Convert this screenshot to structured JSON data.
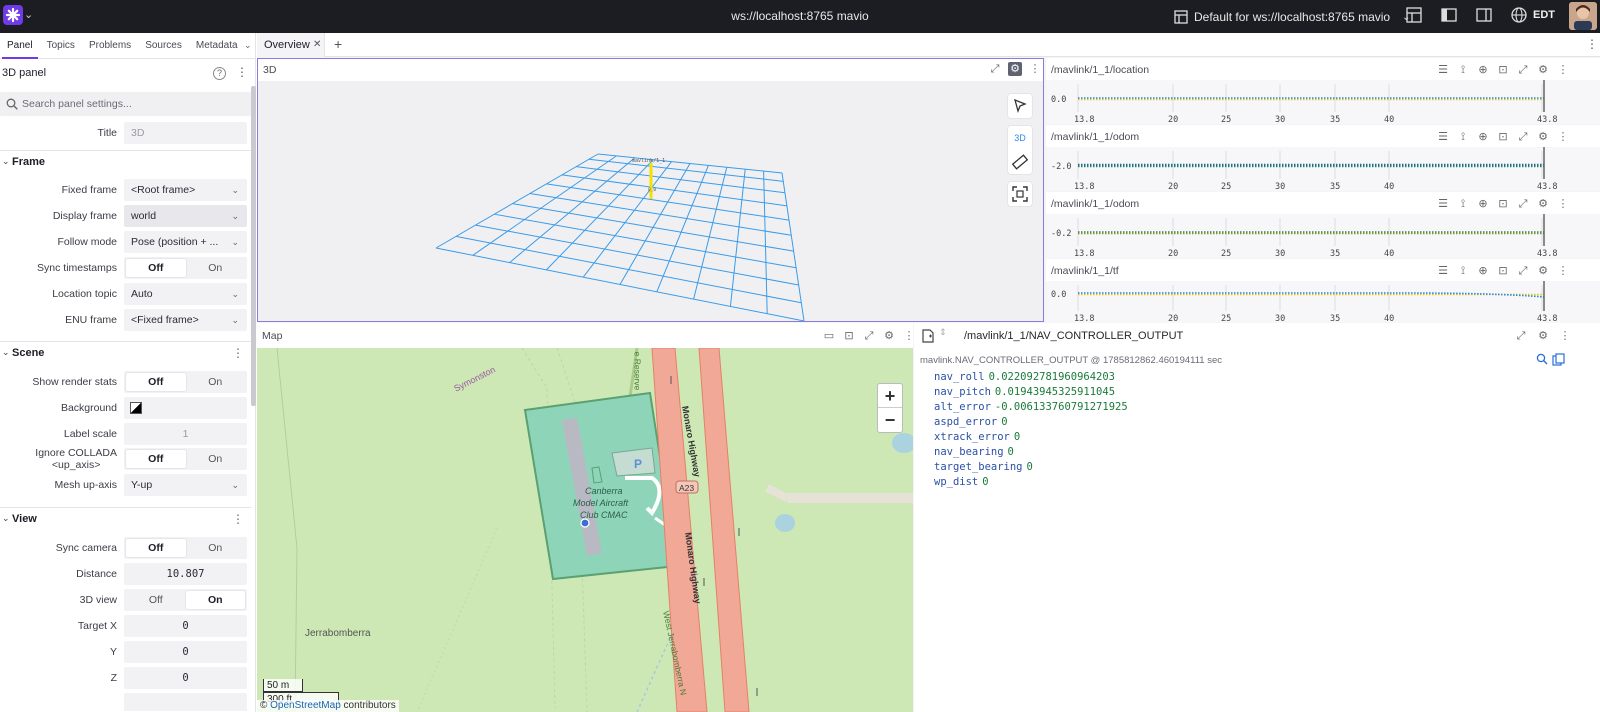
{
  "topbar": {
    "title": "ws://localhost:8765 mavio",
    "layout_name": "Default for ws://localhost:8765 mavio",
    "timezone": "EDT"
  },
  "sidebar": {
    "tabs": [
      "Panel",
      "Topics",
      "Problems",
      "Sources",
      "Metadata"
    ],
    "panel_title": "3D panel",
    "search_placeholder": "Search panel settings...",
    "title_label": "Title",
    "title_value": "3D",
    "frame": {
      "section": "Frame",
      "fixed_frame_label": "Fixed frame",
      "fixed_frame_value": "<Root frame>",
      "display_frame_label": "Display frame",
      "display_frame_value": "world",
      "follow_mode_label": "Follow mode",
      "follow_mode_value": "Pose (position + ...",
      "sync_timestamps_label": "Sync timestamps",
      "location_topic_label": "Location topic",
      "location_topic_value": "Auto",
      "enu_frame_label": "ENU frame",
      "enu_frame_value": "<Fixed frame>"
    },
    "scene": {
      "section": "Scene",
      "show_render_stats_label": "Show render stats",
      "background_label": "Background",
      "label_scale_label": "Label scale",
      "label_scale_value": "1",
      "ignore_collada_label": "Ignore COLLADA",
      "ignore_collada_label2": "<up_axis>",
      "mesh_up_axis_label": "Mesh up-axis",
      "mesh_up_axis_value": "Y-up"
    },
    "view": {
      "section": "View",
      "sync_camera_label": "Sync camera",
      "distance_label": "Distance",
      "distance_value": "10.807",
      "view3d_label": "3D view",
      "target_x_label": "Target X",
      "target_x_value": "0",
      "y_label": "Y",
      "y_value": "0",
      "z_label": "Z",
      "z_value": "0"
    },
    "toggle_off": "Off",
    "toggle_on": "On"
  },
  "tabs": {
    "overview": "Overview"
  },
  "panels": {
    "p3d": {
      "title": "3D",
      "tool_3d": "3D",
      "frame_label": "mavlink/1_1",
      "origin_label": "0_0"
    },
    "plots": [
      {
        "topic": "/mavlink/1_1/location",
        "ylabel": "0.0",
        "color_a": "#1e88e5",
        "color_b": "#f2c200"
      },
      {
        "topic": "/mavlink/1_1/odom",
        "ylabel": "-2.0",
        "color_a": "#1e6f8e",
        "color_b": "#2e8b57"
      },
      {
        "topic": "/mavlink/1_1/odom",
        "ylabel": "-0.2",
        "color_a": "#2e8b57",
        "color_b": "#9a8a14"
      },
      {
        "topic": "/mavlink/1_1/tf",
        "ylabel": "0.0",
        "color_a": "#1e88e5",
        "color_b": "#f2c200"
      }
    ],
    "plot_ticks": [
      "13.8",
      "20",
      "25",
      "30",
      "35",
      "40",
      "43.8"
    ],
    "map": {
      "title": "Map",
      "labels": {
        "symonston": "Symonston",
        "reserve": "e Reserve",
        "monaro1": "Monaro Highway",
        "monaro2": "Monaro Highway",
        "a23": "A23",
        "club1": "Canberra",
        "club2": "Model Aircraft",
        "club3": "Club CMAC",
        "parking": "P",
        "jerra": "Jerrabomberra",
        "west_jerra": "West Jerrabomberra N"
      },
      "scale_m": "50 m",
      "scale_ft": "300 ft",
      "attribution_prefix": "©",
      "attribution_link": "OpenStreetMap",
      "attribution_suffix": "contributors"
    },
    "raw": {
      "topic": "/mavlink/1_1/NAV_CONTROLLER_OUTPUT",
      "meta": "mavlink.NAV_CONTROLLER_OUTPUT @ 1785812862.460194111 sec",
      "fields": [
        {
          "k": "nav_roll",
          "v": "0.022092781960964203"
        },
        {
          "k": "nav_pitch",
          "v": "0.01943945325911045"
        },
        {
          "k": "alt_error",
          "v": "-0.006133760791271925"
        },
        {
          "k": "aspd_error",
          "v": "0"
        },
        {
          "k": "xtrack_error",
          "v": "0"
        },
        {
          "k": "nav_bearing",
          "v": "0"
        },
        {
          "k": "target_bearing",
          "v": "0"
        },
        {
          "k": "wp_dist",
          "v": "0"
        }
      ]
    }
  }
}
